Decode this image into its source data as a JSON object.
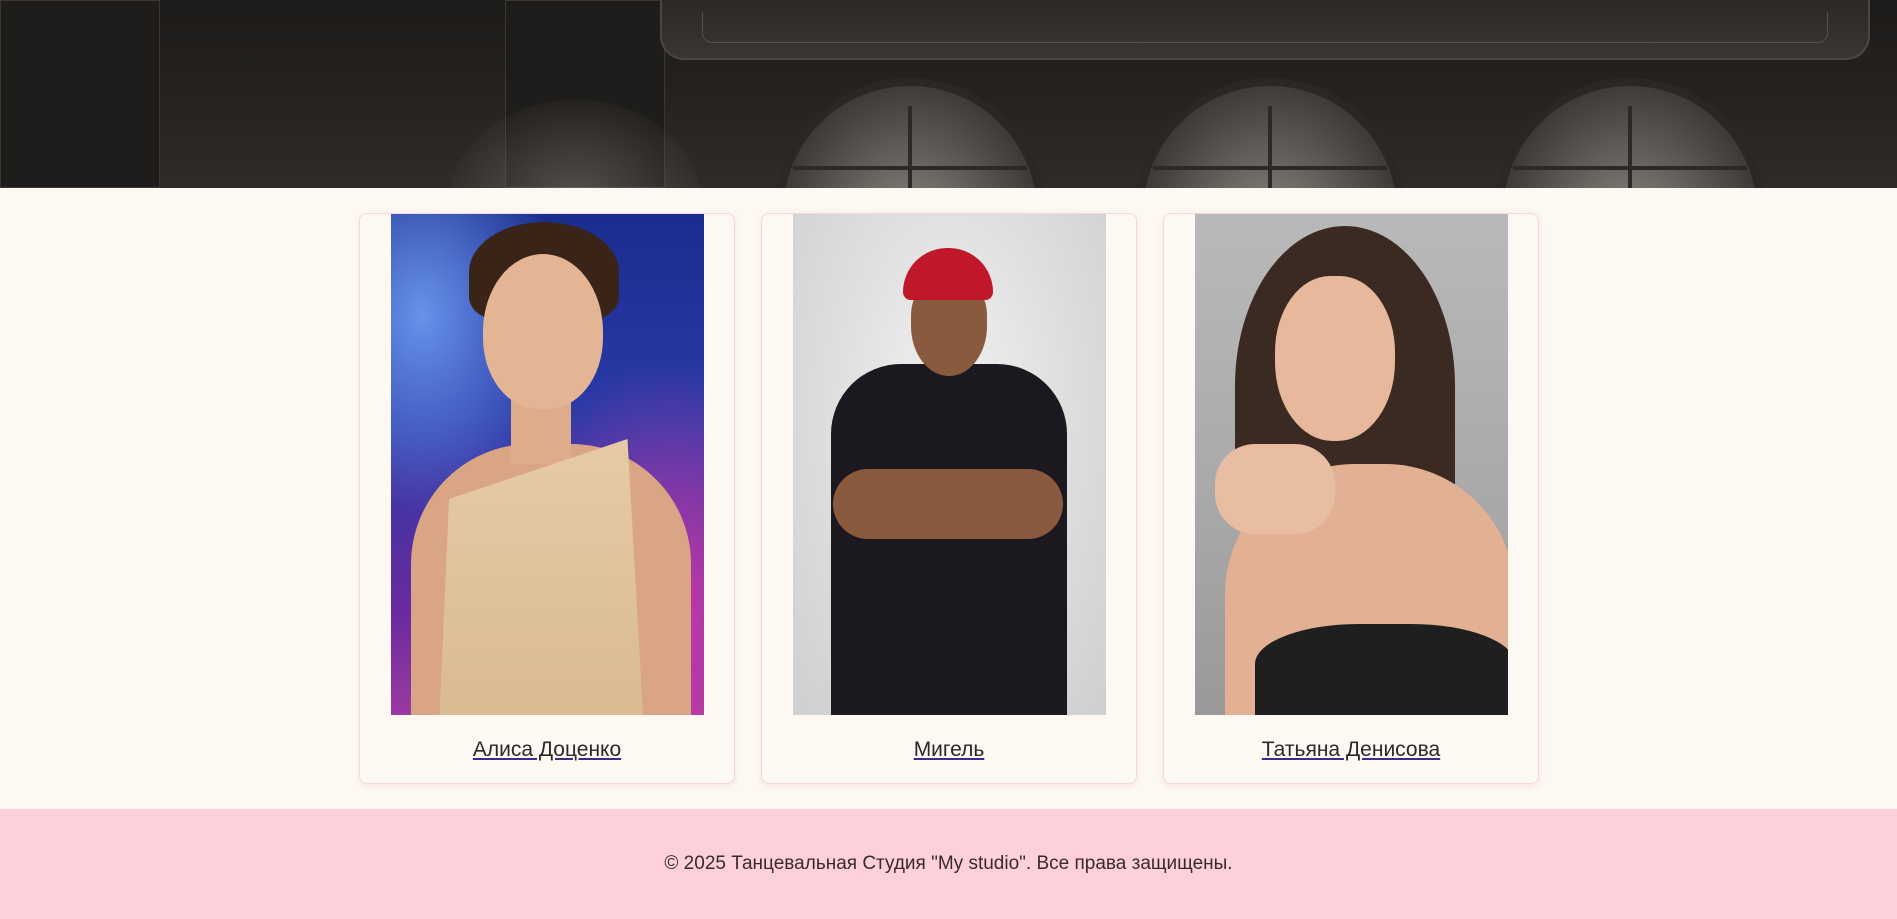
{
  "instructors": [
    {
      "name": "Алиса Доценко",
      "photo_icon": "instructor-photo"
    },
    {
      "name": "Мигель",
      "photo_icon": "instructor-photo"
    },
    {
      "name": "Татьяна Денисова",
      "photo_icon": "instructor-photo"
    }
  ],
  "footer": {
    "copyright": "© 2025 Танцевальная Студия \"My studio\". Все права защищены."
  },
  "colors": {
    "page_background": "#fdf8f2",
    "footer_background": "#fdd0da",
    "card_border": "#f6d6dc",
    "link_underline": "#3d2a8a"
  }
}
